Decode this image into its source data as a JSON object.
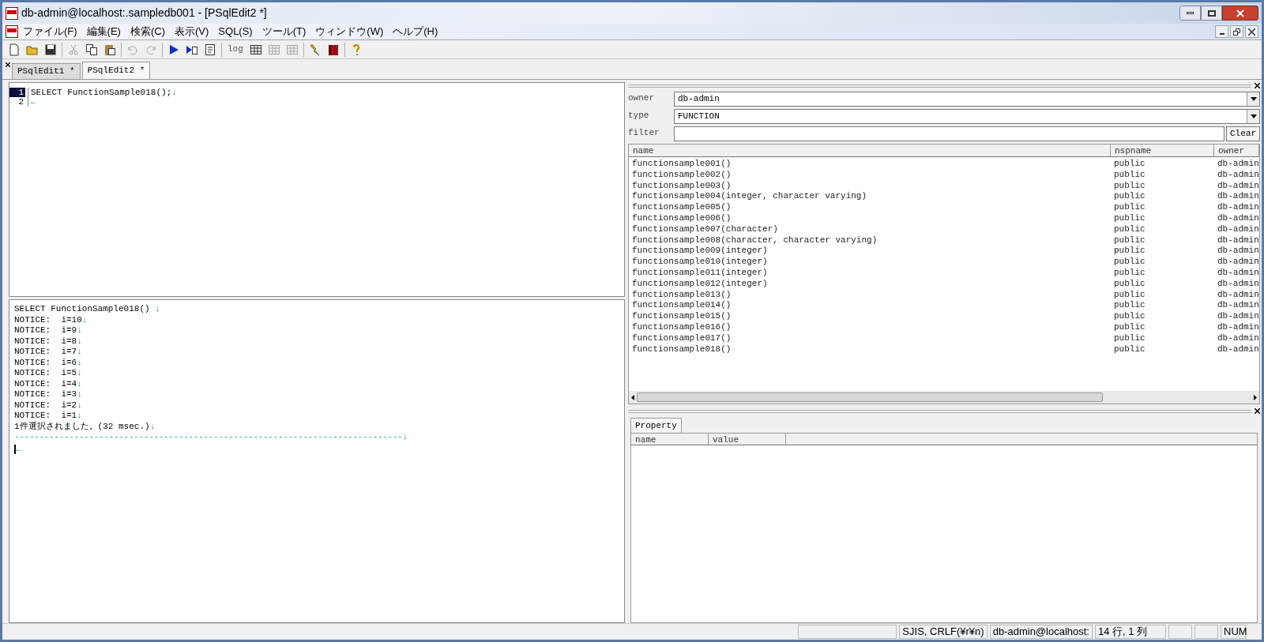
{
  "window": {
    "title": "db-admin@localhost:.sampledb001 - [PSqlEdit2 *]"
  },
  "menu": [
    "ファイル(F)",
    "編集(E)",
    "検索(C)",
    "表示(V)",
    "SQL(S)",
    "ツール(T)",
    "ウィンドウ(W)",
    "ヘルプ(H)"
  ],
  "toolbar": [
    {
      "kind": "new",
      "disabled": false
    },
    {
      "kind": "open",
      "disabled": false
    },
    {
      "kind": "save",
      "disabled": false
    },
    {
      "kind": "sep"
    },
    {
      "kind": "cut",
      "disabled": true
    },
    {
      "kind": "copy",
      "disabled": false
    },
    {
      "kind": "paste",
      "disabled": false
    },
    {
      "kind": "sep"
    },
    {
      "kind": "undo",
      "disabled": true
    },
    {
      "kind": "redo",
      "disabled": true
    },
    {
      "kind": "sep"
    },
    {
      "kind": "run",
      "disabled": false
    },
    {
      "kind": "step",
      "disabled": false
    },
    {
      "kind": "format",
      "disabled": false
    },
    {
      "kind": "sep"
    },
    {
      "kind": "log",
      "label": "log",
      "disabled": false
    },
    {
      "kind": "grid",
      "disabled": false
    },
    {
      "kind": "grid",
      "disabled": true
    },
    {
      "kind": "grid",
      "disabled": true
    },
    {
      "kind": "sep"
    },
    {
      "kind": "bolt",
      "disabled": false
    },
    {
      "kind": "book",
      "disabled": false
    },
    {
      "kind": "sep"
    },
    {
      "kind": "help",
      "disabled": false
    }
  ],
  "tabs": [
    {
      "label": "PSqlEdit1 *",
      "selected": false
    },
    {
      "label": "PSqlEdit2 *",
      "selected": true
    }
  ],
  "editor": {
    "lines": [
      {
        "number": "1",
        "text": "SELECT FunctionSample018();",
        "eol": "↓",
        "current": true
      },
      {
        "number": "2",
        "eol": "←",
        "current": false
      }
    ]
  },
  "output": {
    "lines": [
      {
        "kind": "text",
        "text": "SELECT FunctionSample018() ",
        "eol": "↓"
      },
      {
        "kind": "text",
        "text": "NOTICE:  i=10",
        "eol": "↓"
      },
      {
        "kind": "text",
        "text": "NOTICE:  i=9",
        "eol": "↓"
      },
      {
        "kind": "text",
        "text": "NOTICE:  i=8",
        "eol": "↓"
      },
      {
        "kind": "text",
        "text": "NOTICE:  i=7",
        "eol": "↓"
      },
      {
        "kind": "text",
        "text": "NOTICE:  i=6",
        "eol": "↓"
      },
      {
        "kind": "text",
        "text": "NOTICE:  i=5",
        "eol": "↓"
      },
      {
        "kind": "text",
        "text": "NOTICE:  i=4",
        "eol": "↓"
      },
      {
        "kind": "text",
        "text": "NOTICE:  i=3",
        "eol": "↓"
      },
      {
        "kind": "text",
        "text": "NOTICE:  i=2",
        "eol": "↓"
      },
      {
        "kind": "text",
        "text": "NOTICE:  i=1",
        "eol": "↓"
      },
      {
        "kind": "text",
        "text": "1件選択されました。(32 msec.)",
        "eol": "↓"
      },
      {
        "kind": "separator",
        "text": "------------------------------------------------------------------------------",
        "eol": "↓"
      },
      {
        "kind": "cursor",
        "eol": "←"
      }
    ]
  },
  "object_browser": {
    "fields": [
      {
        "label": "owner",
        "kind": "select",
        "value": "db-admin"
      },
      {
        "label": "type",
        "kind": "select",
        "value": "FUNCTION"
      },
      {
        "label": "filter",
        "kind": "input",
        "button": "Clear"
      }
    ],
    "columns": [
      "name",
      "nspname",
      "owner"
    ],
    "rows": [
      [
        "functionsample001()",
        "public",
        "db-admin"
      ],
      [
        "functionsample002()",
        "public",
        "db-admin"
      ],
      [
        "functionsample003()",
        "public",
        "db-admin"
      ],
      [
        "functionsample004(integer, character varying)",
        "public",
        "db-admin"
      ],
      [
        "functionsample005()",
        "public",
        "db-admin"
      ],
      [
        "functionsample006()",
        "public",
        "db-admin"
      ],
      [
        "functionsample007(character)",
        "public",
        "db-admin"
      ],
      [
        "functionsample008(character, character varying)",
        "public",
        "db-admin"
      ],
      [
        "functionsample009(integer)",
        "public",
        "db-admin"
      ],
      [
        "functionsample010(integer)",
        "public",
        "db-admin"
      ],
      [
        "functionsample011(integer)",
        "public",
        "db-admin"
      ],
      [
        "functionsample012(integer)",
        "public",
        "db-admin"
      ],
      [
        "functionsample013()",
        "public",
        "db-admin"
      ],
      [
        "functionsample014()",
        "public",
        "db-admin"
      ],
      [
        "functionsample015()",
        "public",
        "db-admin"
      ],
      [
        "functionsample016()",
        "public",
        "db-admin"
      ],
      [
        "functionsample017()",
        "public",
        "db-admin"
      ],
      [
        "functionsample018()",
        "public",
        "db-admin"
      ]
    ]
  },
  "property": {
    "tab": "Property",
    "columns": [
      "name",
      "value"
    ]
  },
  "status_bar": [
    {
      "kind": "blank"
    },
    {
      "kind": "text",
      "text": "SJIS, CRLF(¥r¥n)"
    },
    {
      "kind": "text",
      "text": "db-admin@localhost:"
    },
    {
      "kind": "text",
      "text": "14 行, 1 列"
    },
    {
      "kind": "blank"
    },
    {
      "kind": "blank"
    },
    {
      "kind": "text",
      "text": "NUM"
    }
  ]
}
